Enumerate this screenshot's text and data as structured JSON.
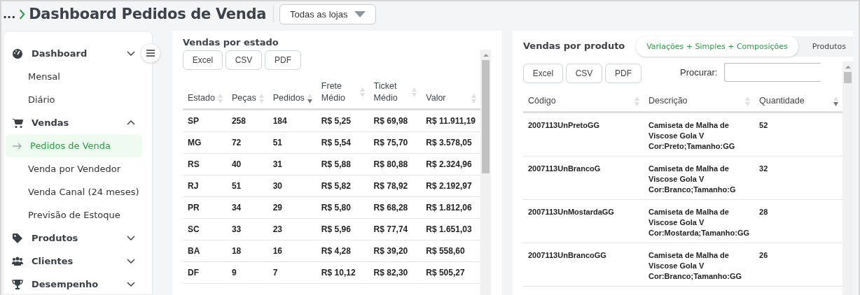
{
  "breadcrumb": {
    "ellipsis": "...",
    "title": "Dashboard Pedidos de Venda"
  },
  "store_select": {
    "value": "Todas as lojas"
  },
  "sidebar": {
    "items": [
      {
        "kind": "group",
        "label": "Dashboard",
        "expanded": false
      },
      {
        "kind": "sub",
        "label": "Mensal",
        "selected": false
      },
      {
        "kind": "sub",
        "label": "Diário",
        "selected": false
      },
      {
        "kind": "group",
        "label": "Vendas",
        "expanded": true
      },
      {
        "kind": "sub",
        "label": "Pedidos de Venda",
        "selected": true
      },
      {
        "kind": "sub",
        "label": "Venda por Vendedor",
        "selected": false
      },
      {
        "kind": "sub",
        "label": "Venda Canal (24 meses)",
        "selected": false
      },
      {
        "kind": "sub",
        "label": "Previsão de Estoque",
        "selected": false
      },
      {
        "kind": "group",
        "label": "Produtos",
        "expanded": false
      },
      {
        "kind": "group",
        "label": "Clientes",
        "expanded": false
      },
      {
        "kind": "group",
        "label": "Desempenho",
        "expanded": false
      }
    ]
  },
  "state_panel": {
    "title": "Vendas por estado",
    "buttons": [
      "Excel",
      "CSV",
      "PDF"
    ],
    "columns": [
      {
        "label": "Estado",
        "sorted": false
      },
      {
        "label": "Peças",
        "sorted": false
      },
      {
        "label": "Pedidos",
        "sorted": true
      },
      {
        "label": "Frete Médio",
        "sorted": false
      },
      {
        "label": "Ticket Médio",
        "sorted": false
      },
      {
        "label": "Valor",
        "sorted": false
      }
    ],
    "rows": [
      [
        "SP",
        "258",
        "184",
        "R$ 5,25",
        "R$ 69,98",
        "R$ 11.911,19"
      ],
      [
        "MG",
        "72",
        "51",
        "R$ 5,54",
        "R$ 75,70",
        "R$ 3.578,05"
      ],
      [
        "RS",
        "40",
        "31",
        "R$ 5,88",
        "R$ 80,88",
        "R$ 2.324,96"
      ],
      [
        "RJ",
        "51",
        "30",
        "R$ 5,82",
        "R$ 78,92",
        "R$ 2.192,97"
      ],
      [
        "PR",
        "34",
        "29",
        "R$ 5,80",
        "R$ 68,28",
        "R$ 1.812,06"
      ],
      [
        "SC",
        "33",
        "23",
        "R$ 5,96",
        "R$ 77,74",
        "R$ 1.651,03"
      ],
      [
        "BA",
        "18",
        "16",
        "R$ 4,28",
        "R$ 39,20",
        "R$ 558,60"
      ],
      [
        "DF",
        "9",
        "7",
        "R$ 10,12",
        "R$ 82,30",
        "R$ 505,27"
      ]
    ]
  },
  "product_panel": {
    "title": "Vendas por produto",
    "tabs": [
      {
        "label": "Variações + Simples + Composições",
        "selected": true
      },
      {
        "label": "Produtos",
        "selected": false
      }
    ],
    "buttons": [
      "Excel",
      "CSV",
      "PDF"
    ],
    "search": {
      "label": "Procurar:"
    },
    "columns": [
      {
        "label": "Código",
        "sorted": false
      },
      {
        "label": "Descrição",
        "sorted": false
      },
      {
        "label": "Quantidade",
        "sorted": true
      }
    ],
    "rows": [
      [
        "2007113UnPretoGG",
        "Camiseta de Malha de Viscose Gola V Cor:Preto;Tamanho:GG",
        "52"
      ],
      [
        "2007113UnBrancoG",
        "Camiseta de Malha de Viscose Gola V Cor:Branco;Tamanho:G",
        "32"
      ],
      [
        "2007113UnMostardaGG",
        "Camiseta de Malha de Viscose Gola V Cor:Mostarda;Tamanho:GG",
        "28"
      ],
      [
        "2007113UnBrancoGG",
        "Camiseta de Malha de Viscose Gola V Cor:Branco;Tamanho:GG",
        "26"
      ]
    ]
  }
}
